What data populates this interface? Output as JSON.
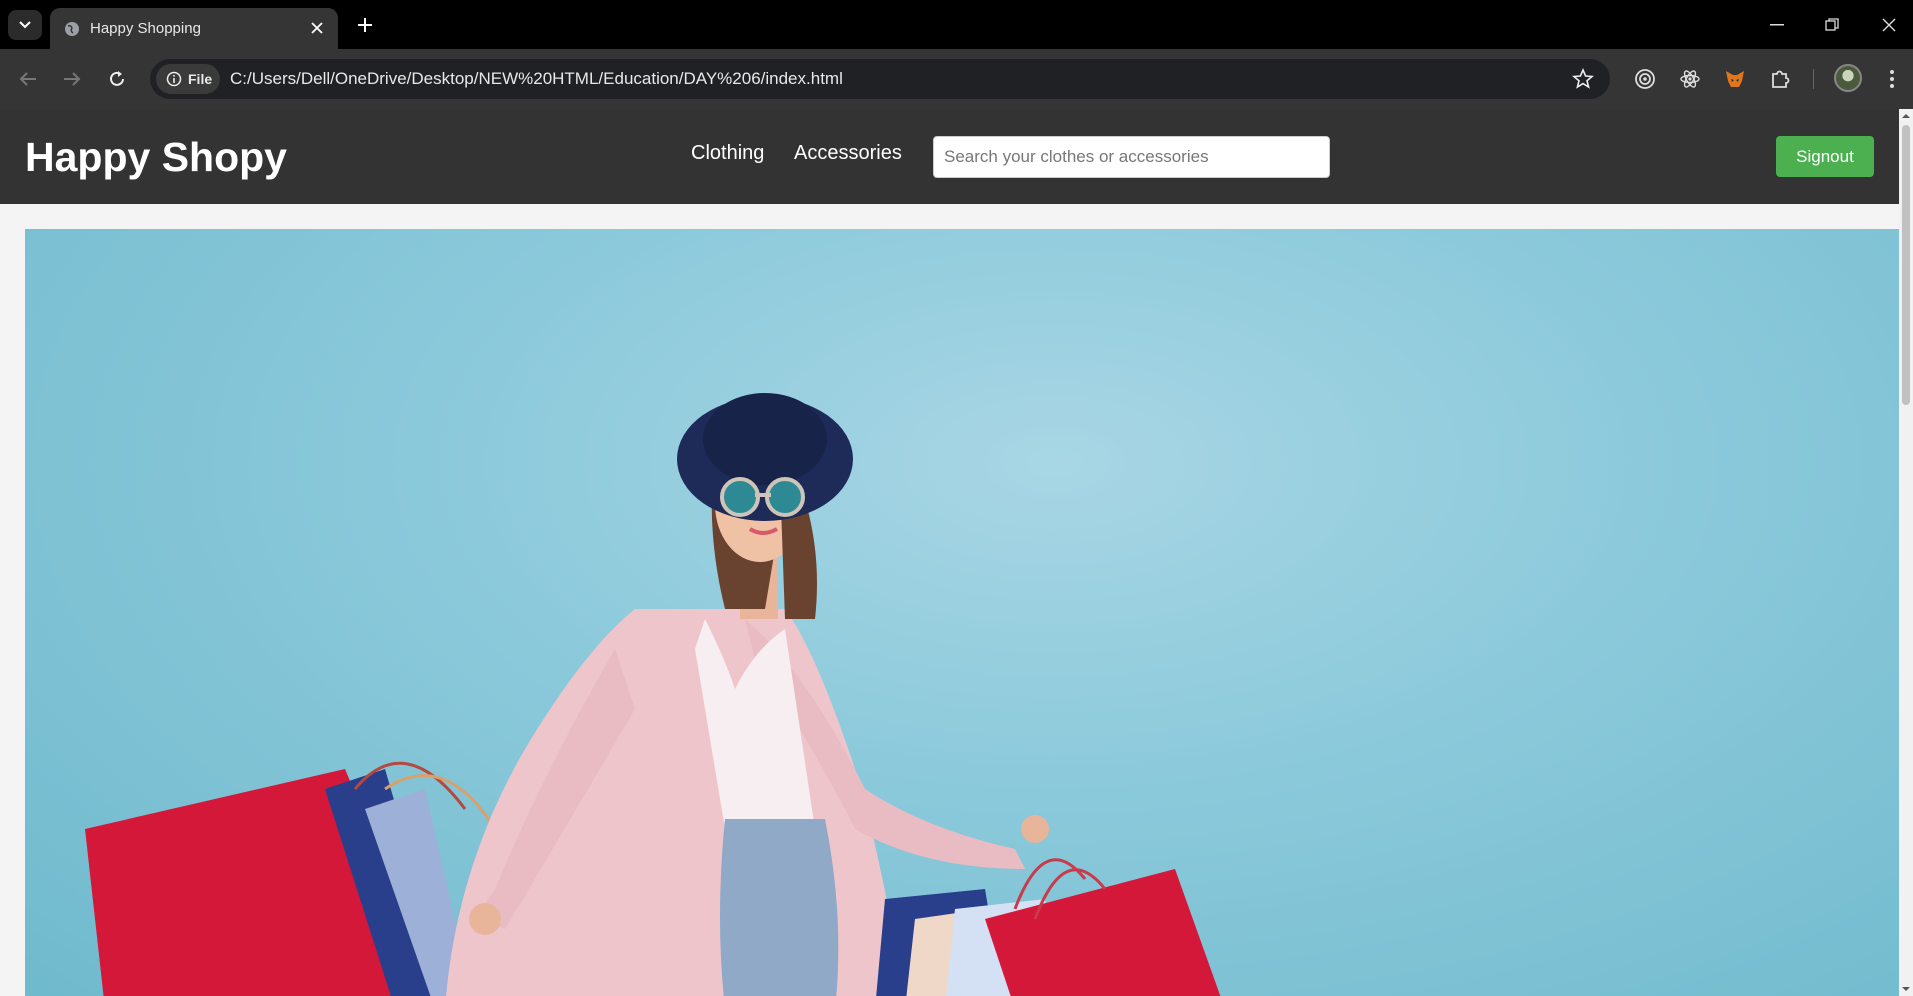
{
  "browser": {
    "tab_title": "Happy Shopping",
    "new_tab_symbol": "+",
    "chip_label": "File",
    "url": "C:/Users/Dell/OneDrive/Desktop/NEW%20HTML/Education/DAY%206/index.html",
    "icons": [
      "tab-list-icon",
      "globe-icon",
      "close-icon",
      "new-tab-icon",
      "minimize-icon",
      "restore-icon",
      "window-close-icon",
      "back-icon",
      "forward-icon",
      "reload-icon",
      "info-icon",
      "star-icon",
      "extension-target-icon",
      "react-devtools-icon",
      "metamask-icon",
      "puzzle-extensions-icon",
      "profile-avatar",
      "menu-icon"
    ]
  },
  "site": {
    "logo": "Happy Shopy",
    "nav": [
      "Clothing",
      "Accessories"
    ],
    "search_placeholder": "Search your clothes or accessories",
    "signout_label": "Signout",
    "colors": {
      "header": "#333333",
      "signout": "#4caf50",
      "hero_bg": "#8ccadb"
    }
  }
}
